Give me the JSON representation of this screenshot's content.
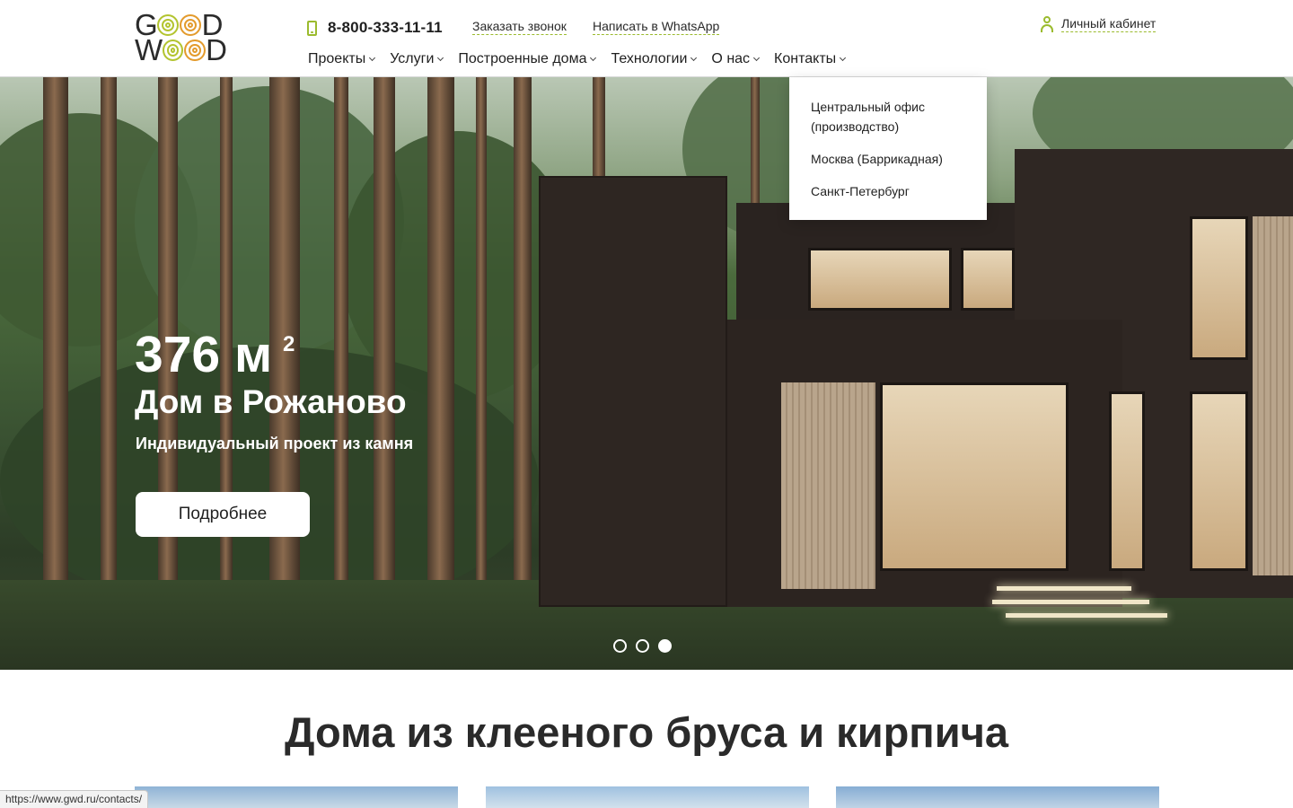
{
  "header": {
    "logo_text": "GOOD WOOD",
    "logo_colors": {
      "green": "#b3c430",
      "orange": "#e39b2d"
    },
    "phone": "8-800-333-11-11",
    "call_link": "Заказать звонок",
    "whatsapp_link": "Написать в WhatsApp",
    "account_link": "Личный кабинет",
    "accent_color": "#9bbb2e"
  },
  "nav": {
    "items": [
      {
        "label": "Проекты"
      },
      {
        "label": "Услуги"
      },
      {
        "label": "Построенные дома"
      },
      {
        "label": "Технологии"
      },
      {
        "label": "О нас"
      },
      {
        "label": "Контакты"
      }
    ]
  },
  "dropdown": {
    "items": [
      {
        "label": "Центральный офис (производство)"
      },
      {
        "label": "Москва (Баррикадная)"
      },
      {
        "label": "Санкт-Петербург"
      }
    ]
  },
  "hero": {
    "area_value": "376 м",
    "area_superscript": "2",
    "title": "Дом в Рожаново",
    "subtitle": "Индивидуальный проект из камня",
    "button_label": "Подробнее",
    "slides": 3,
    "active_slide": 3
  },
  "section": {
    "title": "Дома из клееного бруса и кирпича"
  },
  "statusbar": {
    "url": "https://www.gwd.ru/contacts/"
  }
}
